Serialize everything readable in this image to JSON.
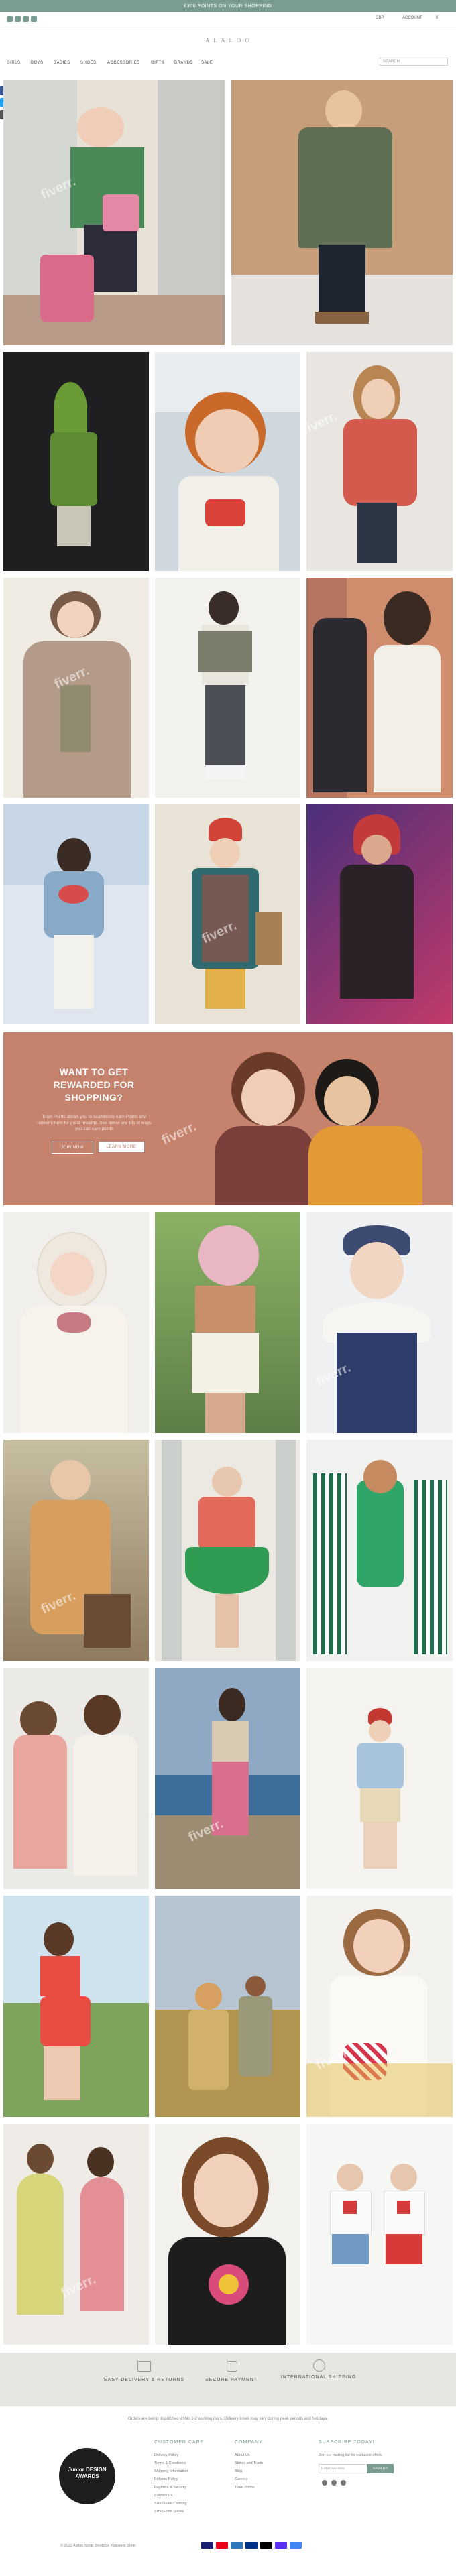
{
  "promo": "£300 POINTS ON YOUR SHOPPING",
  "util": {
    "currency": "GBP",
    "account": "ACCOUNT",
    "cart": "0"
  },
  "logo": "A L A L O O",
  "nav": [
    "GIRLS",
    "BOYS",
    "BABIES",
    "SHOES",
    "ACCESSORIES",
    "GIFTS",
    "BRANDS",
    "SALE"
  ],
  "search": {
    "placeholder": "SEARCH"
  },
  "watermark": "fiverr.",
  "rewards": {
    "title": "WANT TO GET REWARDED FOR SHOPPING?",
    "text": "Town Points allows you to seamlessly earn Points and redeem them for great rewards. See below are lots of ways you can earn points",
    "btn1": "JOIN NOW",
    "btn2": "LEARN MORE"
  },
  "features": [
    "EASY DELIVERY & RETURNS",
    "SECURE PAYMENT",
    "INTERNATIONAL SHIPPING"
  ],
  "notice": "Orders are being dispatched within 1-2 working days. Delivery times may vary during peak periods and holidays.",
  "footer": {
    "badge": "Junior DESIGN AWARDS",
    "customer_title": "CUSTOMER CARE",
    "customer_links": [
      "Delivery Policy",
      "Terms & Conditions",
      "Shipping Information",
      "Returns Policy",
      "Payment & Security",
      "Contact Us",
      "Size Guide Clothing",
      "Size Guide Shoes"
    ],
    "company_title": "COMPANY",
    "company_links": [
      "About Us",
      "Stores and Trade",
      "Blog",
      "Careers",
      "Town Points"
    ],
    "subscribe_title": "SUBSCRIBE TODAY!",
    "subscribe_text": "Join our mailing list for exclusive offers.",
    "email_placeholder": "Email address",
    "signup": "SIGN UP",
    "copyright": "© 2022 Alaloo Shop. Boutique Kidswear Shop."
  },
  "colors": {
    "accent": "#7a9c93",
    "rewards": "#c5826c",
    "footer_band": "#e8e6e3"
  }
}
